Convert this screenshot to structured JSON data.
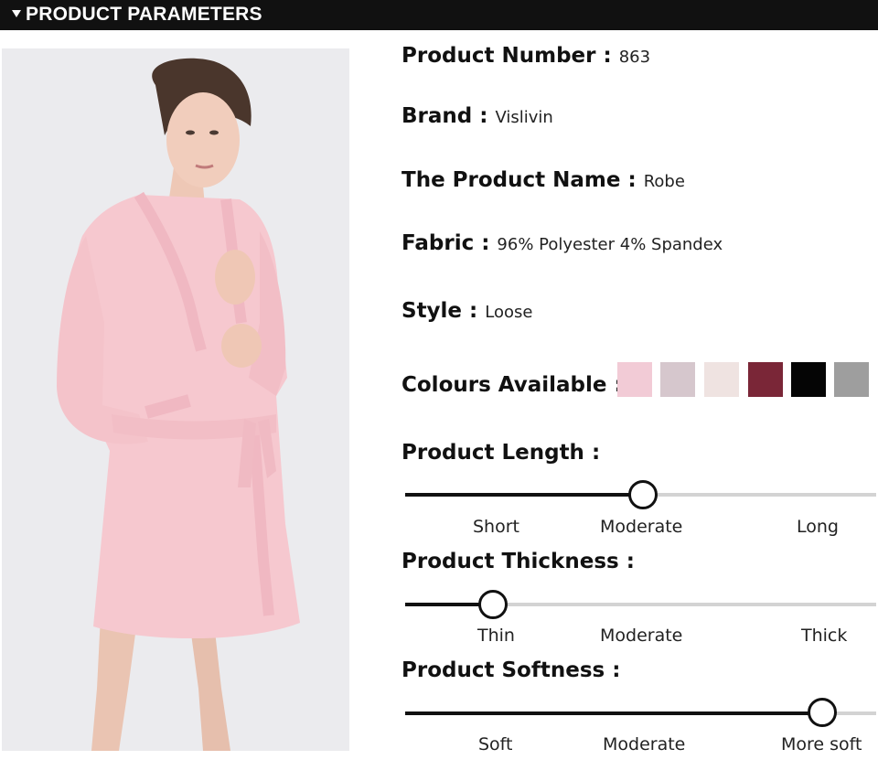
{
  "header": {
    "title": "PRODUCT PARAMETERS"
  },
  "params": {
    "product_number": {
      "label": "Product Number",
      "colon": ":",
      "value": "863"
    },
    "brand": {
      "label": "Brand",
      "colon": ":",
      "value": "Vislivin"
    },
    "product_name": {
      "label": "The Product Name",
      "colon": ":",
      "value": "Robe"
    },
    "fabric": {
      "label": "Fabric",
      "colon": ":",
      "value": "96% Polyester 4% Spandex"
    },
    "style": {
      "label": "Style",
      "colon": ":",
      "value": "Loose"
    },
    "colours": {
      "label": "Colours Available",
      "colon": ":",
      "swatches": [
        "#f2cbd6",
        "#d6c7cd",
        "#efe3e1",
        "#7a2637",
        "#050505",
        "#9e9e9e"
      ]
    }
  },
  "scales": {
    "length": {
      "label": "Product Length",
      "colon": ":",
      "options": [
        "Short",
        "Moderate",
        "Long"
      ],
      "selected": "Moderate"
    },
    "thickness": {
      "label": "Product Thickness",
      "colon": ":",
      "options": [
        "Thin",
        "Moderate",
        "Thick"
      ],
      "selected": "Thin"
    },
    "softness": {
      "label": "Product Softness",
      "colon": ":",
      "options": [
        "Soft",
        "Moderate",
        "More soft"
      ],
      "selected": "More soft"
    }
  },
  "colors": {
    "header_bg": "#111111",
    "slider_fill": "#111111",
    "slider_track": "#d3d3d3",
    "robe": "#f6c8cf"
  }
}
